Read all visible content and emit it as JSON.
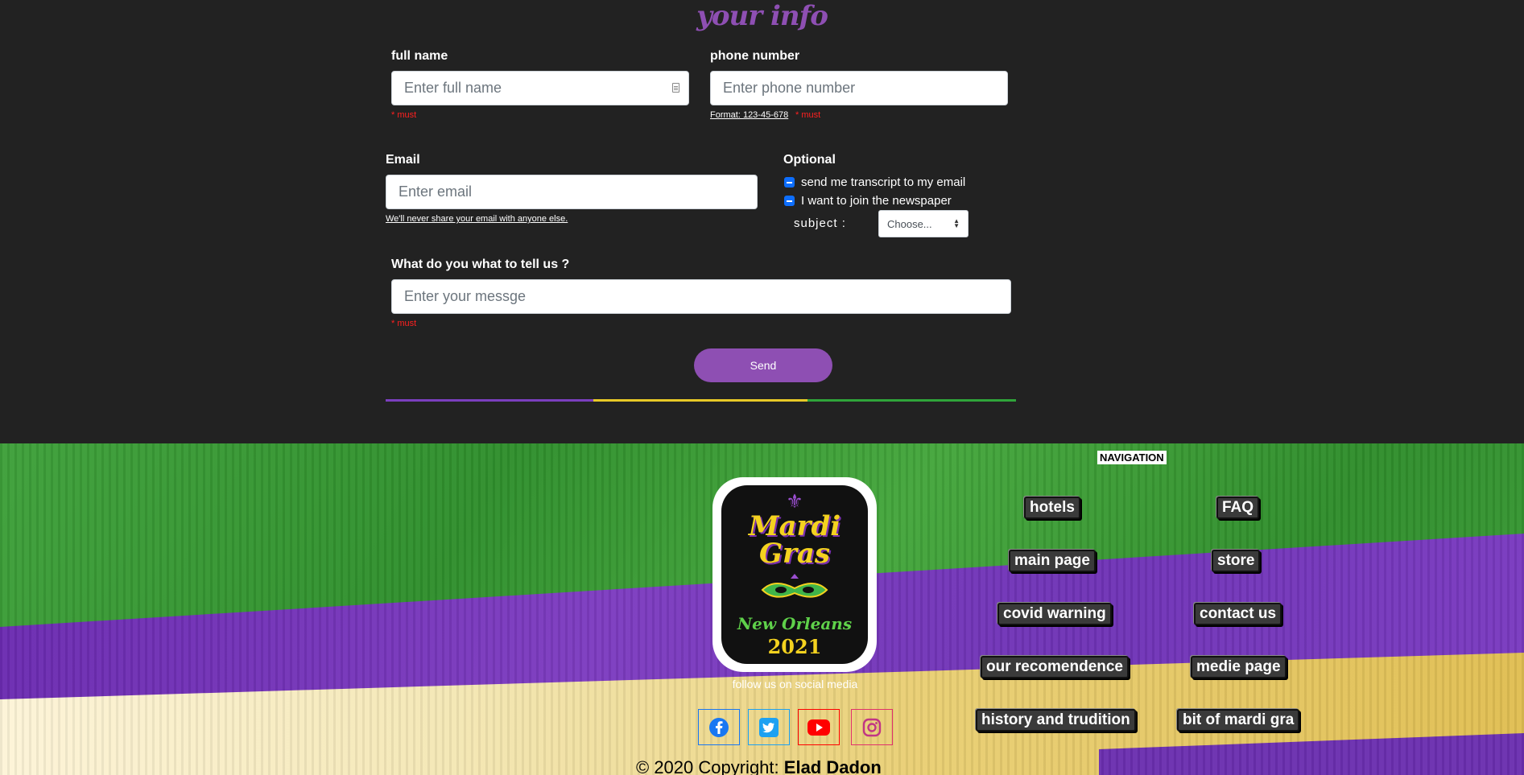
{
  "form": {
    "title": "your info",
    "full_name": {
      "label": "full name",
      "placeholder": "Enter full name",
      "must": "* must"
    },
    "phone": {
      "label": "phone number",
      "placeholder": "Enter phone number",
      "format": "Format: 123-45-678",
      "must": "* must"
    },
    "email": {
      "label": "Email",
      "placeholder": "Enter email",
      "hint": "We'll never share your email with anyone else."
    },
    "optional": {
      "label": "Optional",
      "checkbox_transcript": "send me transcript to my email",
      "checkbox_newspaper": "I want to join the newspaper",
      "subject_label": "subject :",
      "subject_selected": "Choose..."
    },
    "message": {
      "label": "What do you what to tell us ?",
      "placeholder": "Enter your messge",
      "must": "* must"
    },
    "send_label": "Send"
  },
  "colors": {
    "purple": "#8e4fb3",
    "gold": "#e8c927",
    "green": "#2fa43a",
    "must_red": "#ff2020",
    "checkbox_blue": "#0d6efd"
  },
  "footer": {
    "nav_title": "NAVIGATION",
    "nav_left": [
      "hotels",
      "main page",
      "covid warning",
      "our recomendence",
      "history and trudition"
    ],
    "nav_right": [
      "FAQ",
      "store",
      "contact us",
      "medie page",
      "bit of mardi gra"
    ],
    "logo": {
      "line1": "Mardi",
      "line2": "Gras",
      "line3": "New Orleans",
      "line4": "2021"
    },
    "follow_text": "follow us on social media",
    "social": [
      {
        "name": "facebook-icon",
        "color": "#1877f2"
      },
      {
        "name": "twitter-icon",
        "color": "#1da1f2"
      },
      {
        "name": "youtube-icon",
        "color": "#ff0000"
      },
      {
        "name": "instagram-icon",
        "color": "#e1306c"
      }
    ],
    "copyright_prefix": "© 2020 Copyright:",
    "copyright_name": "Elad Dadon"
  }
}
